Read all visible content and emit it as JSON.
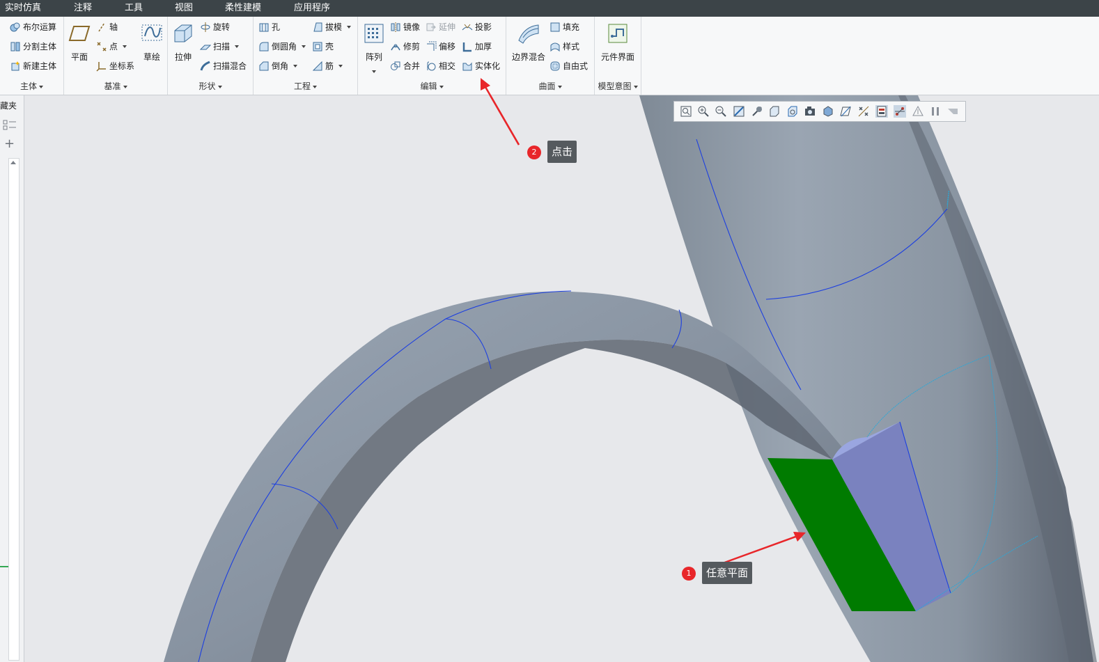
{
  "menubar": {
    "items": [
      "实时仿真",
      "注释",
      "工具",
      "视图",
      "柔性建模",
      "应用程序"
    ]
  },
  "ribbon": {
    "body": {
      "label": "主体",
      "commands": [
        "布尔运算",
        "分割主体",
        "新建主体"
      ]
    },
    "datum": {
      "label": "基准",
      "plane": "平面",
      "axis": "轴",
      "point": "点",
      "csys": "坐标系",
      "sketch": "草绘"
    },
    "shapes": {
      "label": "形状",
      "extrude": "拉伸",
      "revolve": "旋转",
      "sweep": "扫描",
      "swept_blend": "扫描混合"
    },
    "engineering": {
      "label": "工程",
      "hole": "孔",
      "round": "倒圆角",
      "chamfer": "倒角",
      "draft": "拔模",
      "shell": "壳",
      "rib": "筋"
    },
    "editing": {
      "label": "编辑",
      "pattern": "阵列",
      "mirror": "镜像",
      "extend": "延伸",
      "project": "投影",
      "trim": "修剪",
      "offset": "偏移",
      "thicken": "加厚",
      "merge": "合并",
      "intersect": "相交",
      "solidify": "实体化"
    },
    "surfaces": {
      "label": "曲面",
      "boundary_blend": "边界混合",
      "fill": "填充",
      "style": "样式",
      "freestyle": "自由式"
    },
    "model_intent": {
      "label": "模型意图",
      "component_interface": "元件界面"
    }
  },
  "left_panel": {
    "tab_label": "藏夹"
  },
  "annotations": {
    "step1": {
      "number": "1",
      "text": "任意平面"
    },
    "step2": {
      "number": "2",
      "text": "点击"
    }
  },
  "colors": {
    "accent": "#e8262a",
    "selected_face": "#007b00",
    "highlight_face": "#7a82bf",
    "model_surface": "#8d98a6",
    "edge": "#1c3fe0"
  },
  "icons": [
    "zoom-fit-icon",
    "zoom-in-icon",
    "zoom-out-icon",
    "repaint-icon",
    "spin-icon",
    "named-view-icon",
    "view-manager-icon",
    "saved-orientation-icon",
    "display-style-icon",
    "datum-display-icon",
    "annotation-display-icon",
    "selection-filter-icon",
    "spin-center-icon",
    "perspective-icon",
    "pause-icon",
    "flip-icon"
  ]
}
